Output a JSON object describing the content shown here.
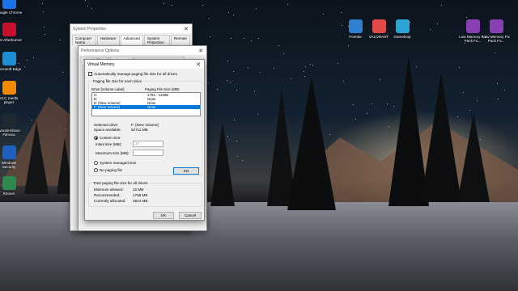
{
  "desktop_icons": {
    "left": [
      {
        "label": "Google Chrome",
        "icon": "chrome-icon",
        "color": "#1a73e8"
      },
      {
        "label": "MSI Afterburner",
        "icon": "afterburner-icon",
        "color": "#c8102e"
      },
      {
        "label": "Microsoft Edge",
        "icon": "edge-icon",
        "color": "#1b8fd6"
      },
      {
        "label": "VLC media player",
        "icon": "vlc-icon",
        "color": "#f08a00"
      },
      {
        "label": "Wondershare Filmora",
        "icon": "filmora-icon",
        "color": "#1e2a2f"
      },
      {
        "label": "Windows Security",
        "icon": "shield-icon",
        "color": "#1f5fbf"
      },
      {
        "label": "R2over",
        "icon": "r2over-icon",
        "color": "#2d8a4e"
      }
    ],
    "right": [
      {
        "label": "Fortnite",
        "icon": "fortnite-icon",
        "color": "#2f7fd1"
      },
      {
        "label": "VALORANT",
        "icon": "valorant-icon",
        "color": "#e24a4a"
      },
      {
        "label": "Gameloop",
        "icon": "gameloop-icon",
        "color": "#2aa3d6"
      },
      {
        "label": "Low Memory Fix Pack Fo...",
        "icon": "archive-icon",
        "color": "#8a3fb5"
      },
      {
        "label": "Low Memory Fix Pack Fo...",
        "icon": "archive-icon",
        "color": "#8a3fb5"
      }
    ]
  },
  "system_properties": {
    "title": "System Properties",
    "tabs": [
      "Computer Name",
      "Hardware",
      "Advanced",
      "System Protection",
      "Remote"
    ],
    "selected_tab": 2,
    "buttons": {
      "ok": "OK",
      "cancel": "Cancel",
      "apply": "Apply"
    }
  },
  "performance_options": {
    "title": "Performance Options",
    "tabs": [
      "Visual Effects",
      "Advanced",
      "Data Execution Prevention"
    ]
  },
  "virtual_memory": {
    "title": "Virtual Memory",
    "auto_manage_label": "Automatically manage paging file size for all drives",
    "auto_manage_checked": false,
    "group1_title": "Paging file size for each drive",
    "columns": [
      "Drive [Volume Label]",
      "Paging File Size (MB)"
    ],
    "drives": [
      {
        "drive": "C:",
        "size": "1794 - 12288"
      },
      {
        "drive": "D:",
        "size": "None"
      },
      {
        "drive": "E:        [New Volume]",
        "size": "None"
      },
      {
        "drive": "F:        [New Volume]",
        "size": "None"
      }
    ],
    "selected_drive_index": 3,
    "selected_drive_label": "Selected drive:",
    "selected_drive_value": "F:  [New Volume]",
    "space_available_label": "Space available:",
    "space_available_value": "52711 MB",
    "custom_size_label": "Custom size:",
    "initial_size_label": "Initial size (MB):",
    "initial_size_value": "17",
    "maximum_size_label": "Maximum size (MB):",
    "maximum_size_value": "",
    "system_managed_label": "System managed size",
    "no_paging_label": "No paging file",
    "selected_option": "custom",
    "set_button": "Set",
    "group2_title": "Total paging file size for all drives",
    "minimum_allowed_label": "Minimum allowed:",
    "minimum_allowed_value": "16 MB",
    "recommended_label": "Recommended:",
    "recommended_value": "1758 MB",
    "currently_allocated_label": "Currently allocated:",
    "currently_allocated_value": "2944 MB",
    "ok_button": "OK",
    "cancel_button": "Cancel"
  }
}
